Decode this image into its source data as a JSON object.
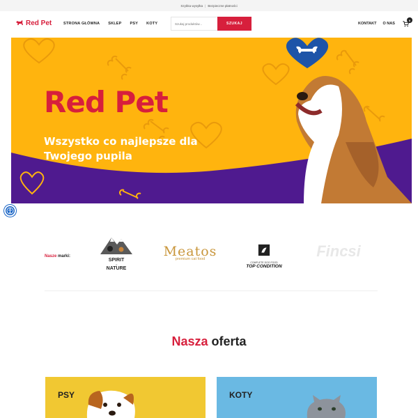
{
  "topbar": {
    "item1": "Szybka wysyłka",
    "separator": "|",
    "item2": "Bezpieczne płatności"
  },
  "header": {
    "logo_text": "Red Pet",
    "nav": [
      "STRONA GŁÓWNA",
      "SKLEP",
      "PSY",
      "KOTY"
    ],
    "search": {
      "placeholder": "Szukaj produktów...",
      "button": "SZUKAJ"
    },
    "right_nav": [
      "KONTAKT",
      "O NAS"
    ],
    "cart_count": "0"
  },
  "hero": {
    "title": "Red Pet",
    "subtitle": "Wszystko co najlepsze dla Twojego pupila"
  },
  "brands": {
    "label_red": "Nasze",
    "label_rest": "marki:",
    "items": [
      {
        "line1": "SPIRIT",
        "line2": "of",
        "line3": "NATURE"
      },
      {
        "name": "Meatos",
        "sub": "premium cat food"
      },
      {
        "sub1": "COMPLETE DOG FOOD",
        "sub2": "TOP CONDITION"
      },
      {
        "name": "Fincsi"
      }
    ]
  },
  "offer": {
    "title_red": "Nasza",
    "title_rest": "oferta",
    "cards": [
      {
        "label": "PSY"
      },
      {
        "label": "KOTY"
      }
    ]
  },
  "colors": {
    "brand_red": "#d71f3c",
    "hero_yellow": "#ffb40e",
    "hero_purple": "#4f1a8f",
    "card_psy": "#f1c832",
    "card_koty": "#6ab9e3"
  }
}
